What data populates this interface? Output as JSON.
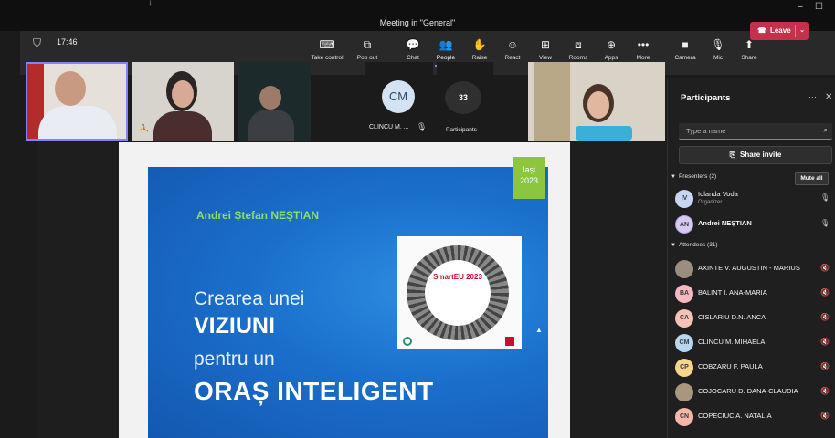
{
  "window": {
    "title": "Meeting in \"General\"",
    "minimize_glyph": "–",
    "maximize_glyph": "☐"
  },
  "toolbar": {
    "timer": "17:46",
    "buttons": [
      {
        "label": "Take control",
        "icon": "⌨"
      },
      {
        "label": "Pop out",
        "icon": "⧉"
      },
      {
        "label": "Chat",
        "icon": "💬"
      },
      {
        "label": "People",
        "icon": "👥"
      },
      {
        "label": "Raise",
        "icon": "✋"
      },
      {
        "label": "React",
        "icon": "☺"
      },
      {
        "label": "View",
        "icon": "⊞"
      },
      {
        "label": "Rooms",
        "icon": "⧈"
      },
      {
        "label": "Apps",
        "icon": "⊕"
      },
      {
        "label": "More",
        "icon": "•••"
      },
      {
        "label": "Camera",
        "icon": "■"
      },
      {
        "label": "Mic",
        "icon": "🎙"
      },
      {
        "label": "Share",
        "icon": "⬆"
      }
    ],
    "leave_label": "Leave",
    "active_button": "People"
  },
  "video_strip": {
    "tile_initials": "CM",
    "tile_name": "CLINCU M. ...",
    "participants_count": "33",
    "participants_label": "Participants"
  },
  "slide": {
    "year_badge_line1": "Iași",
    "year_badge_line2": "2023",
    "presenter": "Andrei Ștefan NEȘTIAN",
    "line1": "Crearea unei",
    "line2": "VIZIUNI",
    "line3": "pentru un",
    "line4": "ORAȘ INTELIGENT",
    "poster_brand": "SmartEU 2023"
  },
  "panel": {
    "title": "Participants",
    "search_placeholder": "Type a name",
    "share_invite": "Share invite",
    "presenters_header": "Presenters (2)",
    "mute_all": "Mute all",
    "presenters": [
      {
        "initials": "IV",
        "name": "Iolanda Voda",
        "role": "Organizer",
        "color": "#c7d7f2"
      },
      {
        "initials": "AN",
        "name": "Andrei NEȘTIAN",
        "role": "",
        "color": "#d8c9f0"
      }
    ],
    "attendees_header": "Attendees (31)",
    "attendees": [
      {
        "initials": "",
        "name": "AXINTE V. AUGUSTIN - MARIUS",
        "color": "#9b8e80"
      },
      {
        "initials": "BA",
        "name": "BALINT I. ANA-MARIA",
        "color": "#f3b8c0"
      },
      {
        "initials": "CA",
        "name": "CISLARIU D.N. ANCA",
        "color": "#f5c2b8"
      },
      {
        "initials": "CM",
        "name": "CLINCU M. MIHAELA",
        "color": "#b8d6ee"
      },
      {
        "initials": "CP",
        "name": "COBZARU F. PAULA",
        "color": "#f5d58a"
      },
      {
        "initials": "",
        "name": "COJOCARU D. DANA-CLAUDIA",
        "color": "#a8967e"
      },
      {
        "initials": "CN",
        "name": "COPECIUC A. NATALIA",
        "color": "#f5b8a8"
      }
    ]
  }
}
